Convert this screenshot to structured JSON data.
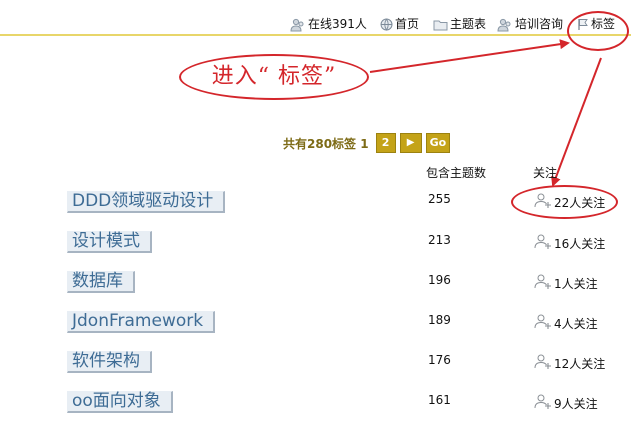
{
  "nav": {
    "online": "在线391人",
    "home": "首页",
    "topics": "主题表",
    "training": "培训咨询",
    "tags": "标签"
  },
  "callout": {
    "text": "进入“ 标签”"
  },
  "pager": {
    "summary": "共有280标签 1",
    "page2": "2",
    "next": "▶",
    "go": "Go"
  },
  "columns": {
    "count": "包含主题数",
    "follow": "关注"
  },
  "tags": [
    {
      "name": "DDD领域驱动设计",
      "count": "255",
      "follow": "22人关注"
    },
    {
      "name": "设计模式",
      "count": "213",
      "follow": "16人关注"
    },
    {
      "name": "数据库",
      "count": "196",
      "follow": "1人关注"
    },
    {
      "name": "JdonFramework",
      "count": "189",
      "follow": "4人关注"
    },
    {
      "name": "软件架构",
      "count": "176",
      "follow": "12人关注"
    },
    {
      "name": "oo面向对象",
      "count": "161",
      "follow": "9人关注"
    }
  ],
  "colors": {
    "annotation": "#d4262b",
    "nav_rule": "#e8d66a",
    "pager_button": "#c4a318",
    "tag_text": "#3e6c95",
    "tag_bg": "#e8eef4"
  }
}
